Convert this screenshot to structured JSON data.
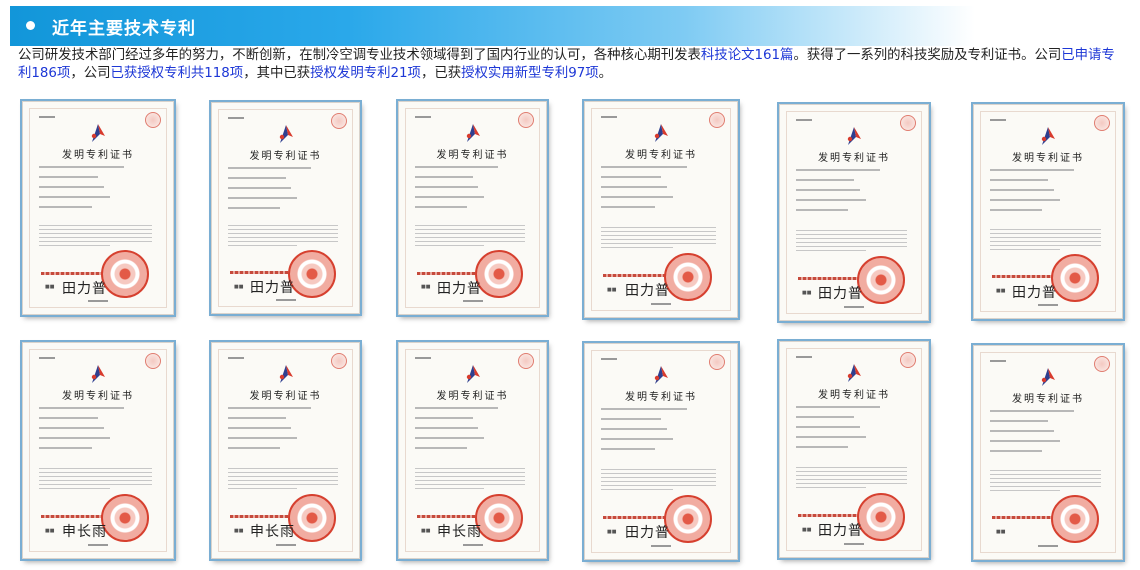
{
  "header": {
    "title": "近年主要技术专利",
    "accent_color": "#1296d9"
  },
  "intro": {
    "part1": "公司研发技术部门经过多年的努力，不断创新，在制冷空调专业技术领域得到了国内行业的认可，各种核心期刊发表",
    "hl1": "科技论文161篇",
    "part2": "。获得了一系列的科技奖励及专利证书。公司",
    "hl2": "已申请专利186项",
    "part3": "，公司",
    "hl3": "已获授权专利共118项",
    "part4": "，其中已获",
    "hl4": "授权发明专利21项",
    "part5": "，已获",
    "hl5": "授权实用新型专利97项",
    "part6": "。",
    "highlight_color": "#1d37d6"
  },
  "certificates": [
    {
      "title": "发明专利证书",
      "signature": "田力普",
      "icon": "patent-office-logo-icon"
    },
    {
      "title": "发明专利证书",
      "signature": "田力普",
      "icon": "patent-office-logo-icon"
    },
    {
      "title": "发明专利证书",
      "signature": "田力普",
      "icon": "patent-office-logo-icon"
    },
    {
      "title": "发明专利证书",
      "signature": "田力普",
      "icon": "patent-office-logo-icon"
    },
    {
      "title": "发明专利证书",
      "signature": "田力普",
      "icon": "patent-office-logo-icon"
    },
    {
      "title": "发明专利证书",
      "signature": "田力普",
      "icon": "patent-office-logo-icon"
    },
    {
      "title": "发明专利证书",
      "signature": "申长雨",
      "icon": "patent-office-logo-icon"
    },
    {
      "title": "发明专利证书",
      "signature": "申长雨",
      "icon": "patent-office-logo-icon"
    },
    {
      "title": "发明专利证书",
      "signature": "申长雨",
      "icon": "patent-office-logo-icon"
    },
    {
      "title": "发明专利证书",
      "signature": "田力普",
      "icon": "patent-office-logo-icon"
    },
    {
      "title": "发明专利证书",
      "signature": "田力普",
      "icon": "patent-office-logo-icon"
    },
    {
      "title": "发明专利证书",
      "signature": "",
      "icon": "patent-office-logo-icon"
    }
  ]
}
